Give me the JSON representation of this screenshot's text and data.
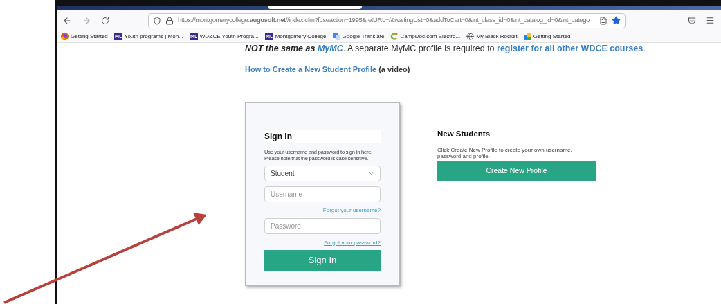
{
  "toolbar": {
    "url": "https://montgomerycollege.**augusoft.net**//index.cfm?fuseaction=1995&retURL=/&waitingList=0&addToCart=0&int_class_id=0&int_catalog_id=0&int_catego"
  },
  "bookmarks": [
    {
      "label": "Getting Started",
      "kind": "firefox"
    },
    {
      "label": "Youth programs | Mon...",
      "kind": "mc"
    },
    {
      "label": "WD&CE Youth Progra...",
      "kind": "mc"
    },
    {
      "label": "Montgomery College",
      "kind": "mc"
    },
    {
      "label": "Google Translate",
      "kind": "translate"
    },
    {
      "label": "CampDoc.com Electro...",
      "kind": "campdoc"
    },
    {
      "label": "My Black Rocket",
      "kind": "globe"
    },
    {
      "label": "Getting Started",
      "kind": "starter"
    }
  ],
  "intro": [
    {
      "text": "NOT the same as ",
      "kind": "emphasis"
    },
    {
      "text": "MyMC",
      "kind": "emphasis-link"
    },
    {
      "text": ". A separate MyMC profile is required to ",
      "kind": "plain"
    },
    {
      "text": "register for all other WDCE courses",
      "kind": "link"
    },
    {
      "text": ".",
      "kind": "plain"
    }
  ],
  "video": {
    "link": "How to Create a New Student Profile",
    "note": "(a video)"
  },
  "sign_in": {
    "title": "Sign In",
    "description": "Use your username and password to sign in here. Please note that the password is case sensitive.",
    "role": "Student",
    "username_placeholder": "Username",
    "forgot_username": "Forgot your username?",
    "password_placeholder": "Password",
    "forgot_password": "Forgot your password?",
    "button": "Sign In"
  },
  "new_students": {
    "title": "New Students",
    "description": "Click Create New Profile to create your own username, password and profile.",
    "button": "Create New Profile"
  }
}
